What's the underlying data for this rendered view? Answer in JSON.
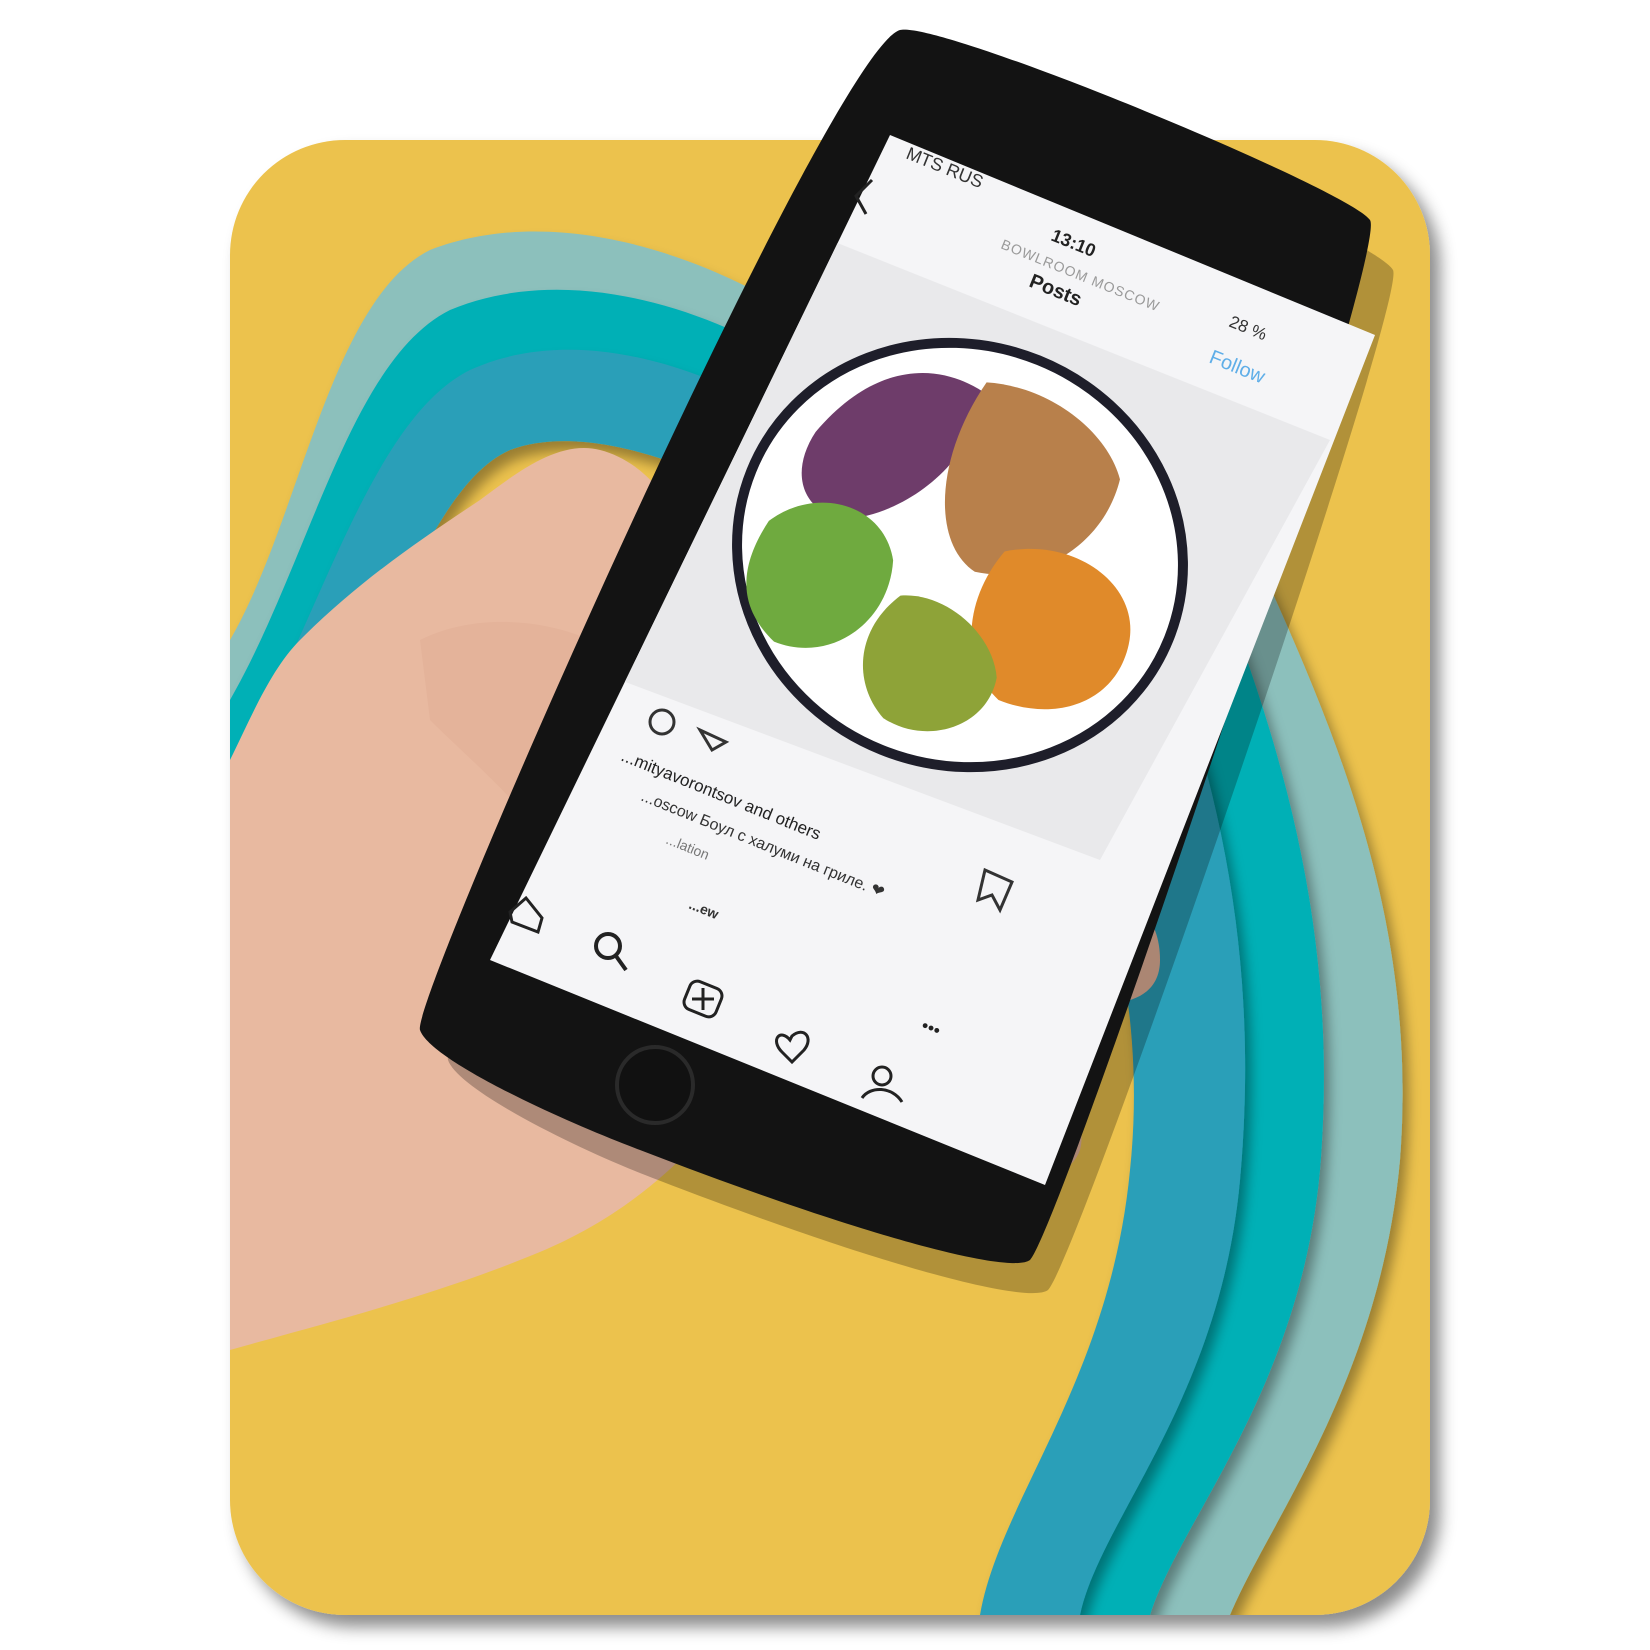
{
  "colors": {
    "card_yellow": "#ECC24E",
    "stripe_light": "#8CC0BC",
    "stripe_teal": "#06B0B6",
    "stripe_blue": "#2C9FB8",
    "phone_body": "#131313",
    "screen_bg": "#F5F5F7",
    "follow_blue": "#5FAEE8",
    "skin": "#E8B9A0"
  },
  "status_bar": {
    "carrier": "MTS RUS",
    "time": "13:10",
    "battery": "28 %"
  },
  "header": {
    "back_icon": "chevron-left-icon",
    "account": "BOWLROOM MOSCOW",
    "title": "Posts",
    "follow_label": "Follow"
  },
  "post": {
    "image": "food-bowl-photo",
    "likes_line": "...mityavorontsov and others",
    "caption_line": "...oscow Боул с халуми на гриле. ❤",
    "translation_line": "...lation",
    "view_line": "...ew"
  },
  "tab_bar": {
    "items": [
      "home-icon",
      "search-icon",
      "add-post-icon",
      "heart-icon",
      "profile-icon"
    ]
  }
}
